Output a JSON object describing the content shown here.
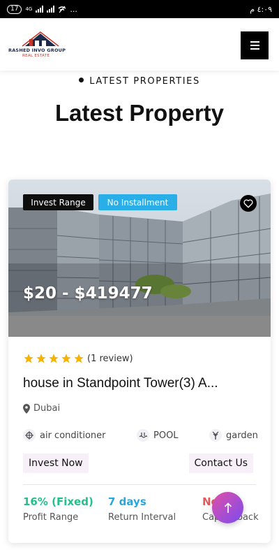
{
  "status_bar": {
    "left_badge": "17",
    "network": "4G",
    "time": "٤:٠٩ م",
    "more": "..."
  },
  "header": {
    "logo_line1": "RASHED INVO GROUP",
    "logo_line2": "REAL ESTATE"
  },
  "section": {
    "eyebrow": "LATEST PROPERTIES",
    "title": "Latest Property"
  },
  "card": {
    "badges": {
      "invest_range": "Invest Range",
      "installment": "No Installment"
    },
    "price": "$20 - $419477",
    "rating": {
      "stars": 5,
      "review_text": "(1 review)",
      "star_color": "#f6b300"
    },
    "title": "house in Standpoint Tower(3) A...",
    "location": "Dubai",
    "amenities": [
      {
        "label": "air conditioner",
        "icon": "air-conditioner-icon"
      },
      {
        "label": "POOL",
        "icon": "pool-icon"
      },
      {
        "label": "garden",
        "icon": "garden-icon"
      }
    ],
    "buttons": {
      "invest_now": "Invest Now",
      "contact_us": "Contact Us"
    },
    "stats": [
      {
        "value": "16% (Fixed)",
        "label": "Profit Range",
        "color": "#22c08a"
      },
      {
        "value": "7 days",
        "label": "Return Interval",
        "color": "#27a6e0"
      },
      {
        "value": "No",
        "label": "Capital back",
        "color": "#e05b5b"
      }
    ]
  },
  "colors": {
    "accent_badge": "#2aaee8",
    "fab_gradient_start": "#e14fa7",
    "fab_gradient_end": "#7a4cf0"
  }
}
